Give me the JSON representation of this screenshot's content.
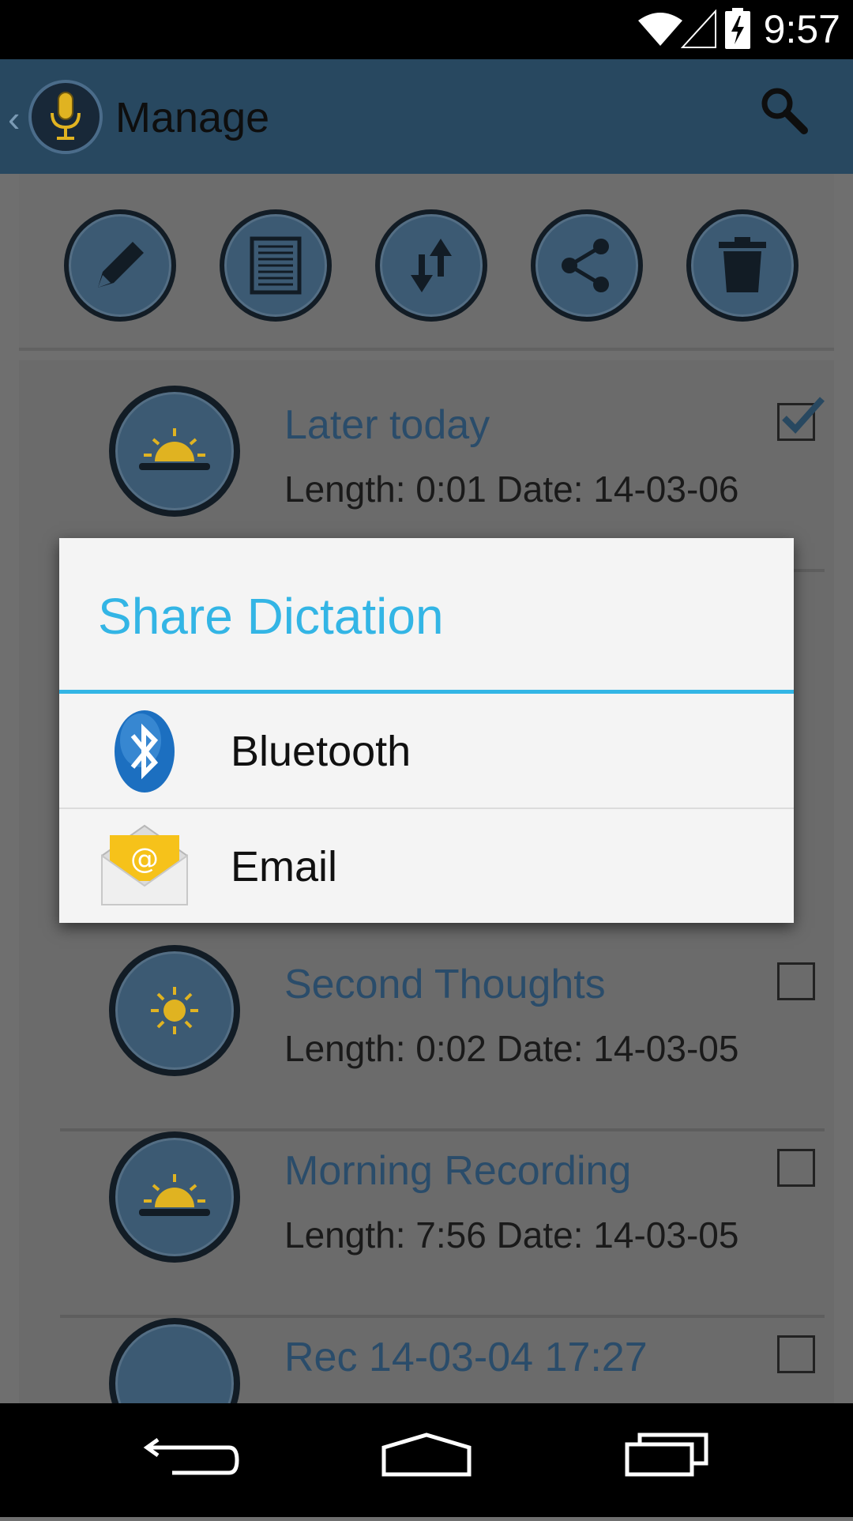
{
  "status": {
    "time": "9:57"
  },
  "header": {
    "back": "‹",
    "title": "Manage"
  },
  "toolbar": {
    "buttons": [
      {
        "name": "edit"
      },
      {
        "name": "document"
      },
      {
        "name": "sort"
      },
      {
        "name": "share"
      },
      {
        "name": "delete"
      }
    ]
  },
  "recordings": [
    {
      "title": "Later today",
      "meta": "Length: 0:01 Date: 14-03-06",
      "checked": true,
      "icon": "sunrise-icon"
    },
    {
      "title": "Second Thoughts",
      "meta": "Length: 0:02 Date: 14-03-05",
      "checked": false,
      "icon": "sun-icon"
    },
    {
      "title": "Morning Recording",
      "meta": "Length: 7:56 Date: 14-03-05",
      "checked": false,
      "icon": "sunrise-icon"
    },
    {
      "title": "Rec 14-03-04 17:27",
      "meta": "",
      "checked": false,
      "icon": "sunrise-icon"
    }
  ],
  "dialog": {
    "title": "Share Dictation",
    "options": [
      {
        "label": "Bluetooth",
        "icon": "bluetooth-icon"
      },
      {
        "label": "Email",
        "icon": "email-icon"
      }
    ]
  },
  "colors": {
    "accent": "#33b5e5",
    "actionbar": "#284860",
    "list_title": "#2a4c6a"
  }
}
